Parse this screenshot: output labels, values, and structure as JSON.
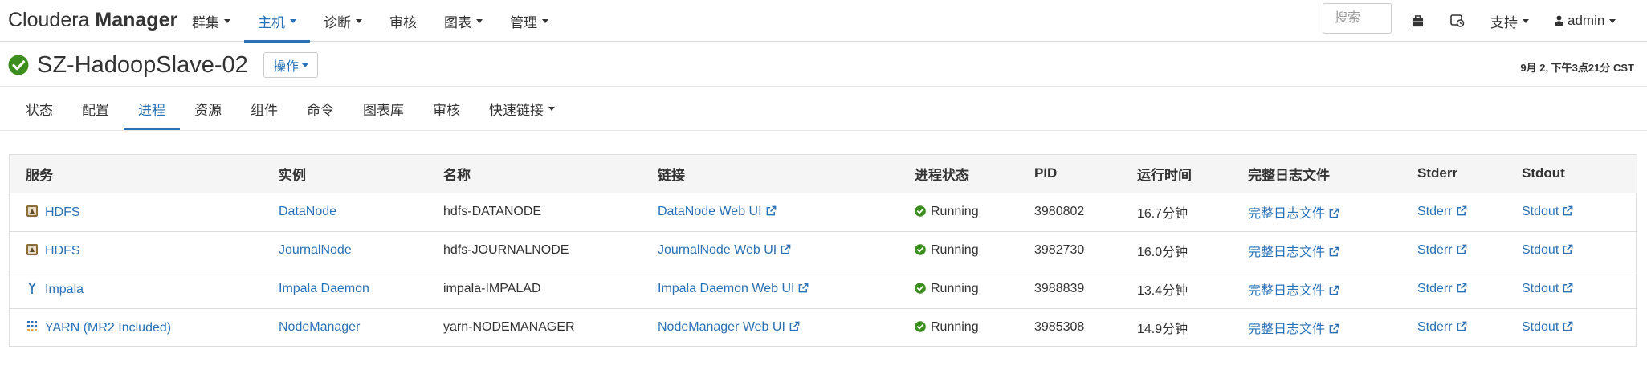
{
  "app": {
    "brand_light": "Cloudera",
    "brand_bold": "Manager"
  },
  "topnav": {
    "items": [
      {
        "label": "群集",
        "dropdown": true,
        "active": false
      },
      {
        "label": "主机",
        "dropdown": true,
        "active": true
      },
      {
        "label": "诊断",
        "dropdown": true,
        "active": false
      },
      {
        "label": "审核",
        "dropdown": false,
        "active": false
      },
      {
        "label": "图表",
        "dropdown": true,
        "active": false
      },
      {
        "label": "管理",
        "dropdown": true,
        "active": false
      }
    ],
    "search_placeholder": "搜索",
    "icons": [
      "briefcase-icon",
      "running-commands-icon"
    ],
    "support_label": "支持",
    "user_label": "admin"
  },
  "host": {
    "status": "good",
    "status_icon": "check-circle-icon",
    "status_color": "#3c8f1f",
    "name": "SZ-HadoopSlave-02",
    "actions_label": "操作",
    "time": "9月 2, 下午3点21分 CST"
  },
  "subtabs": [
    {
      "label": "状态",
      "active": false,
      "dropdown": false
    },
    {
      "label": "配置",
      "active": false,
      "dropdown": false
    },
    {
      "label": "进程",
      "active": true,
      "dropdown": false
    },
    {
      "label": "资源",
      "active": false,
      "dropdown": false
    },
    {
      "label": "组件",
      "active": false,
      "dropdown": false
    },
    {
      "label": "命令",
      "active": false,
      "dropdown": false
    },
    {
      "label": "图表库",
      "active": false,
      "dropdown": false
    },
    {
      "label": "审核",
      "active": false,
      "dropdown": false
    },
    {
      "label": "快速链接",
      "active": false,
      "dropdown": true
    }
  ],
  "colors": {
    "accent": "#2a71b5",
    "running": "#3c8f1f",
    "header_bg": "#f5f5f5",
    "border": "#dddddd"
  },
  "table": {
    "columns": [
      "服务",
      "实例",
      "名称",
      "链接",
      "进程状态",
      "PID",
      "运行时间",
      "完整日志文件",
      "Stderr",
      "Stdout"
    ],
    "rows": [
      {
        "service": "HDFS",
        "service_icon": "hdfs-icon",
        "instance": "DataNode",
        "name": "hdfs-DATANODE",
        "link": "DataNode Web UI",
        "status": "Running",
        "pid": "3980802",
        "uptime": "16.7分钟",
        "log": "完整日志文件",
        "stderr": "Stderr",
        "stdout": "Stdout"
      },
      {
        "service": "HDFS",
        "service_icon": "hdfs-icon",
        "instance": "JournalNode",
        "name": "hdfs-JOURNALNODE",
        "link": "JournalNode Web UI",
        "status": "Running",
        "pid": "3982730",
        "uptime": "16.0分钟",
        "log": "完整日志文件",
        "stderr": "Stderr",
        "stdout": "Stdout"
      },
      {
        "service": "Impala",
        "service_icon": "impala-icon",
        "instance": "Impala Daemon",
        "name": "impala-IMPALAD",
        "link": "Impala Daemon Web UI",
        "status": "Running",
        "pid": "3988839",
        "uptime": "13.4分钟",
        "log": "完整日志文件",
        "stderr": "Stderr",
        "stdout": "Stdout"
      },
      {
        "service": "YARN (MR2 Included)",
        "service_icon": "yarn-icon",
        "instance": "NodeManager",
        "name": "yarn-NODEMANAGER",
        "link": "NodeManager Web UI",
        "status": "Running",
        "pid": "3985308",
        "uptime": "14.9分钟",
        "log": "完整日志文件",
        "stderr": "Stderr",
        "stdout": "Stdout"
      }
    ]
  }
}
